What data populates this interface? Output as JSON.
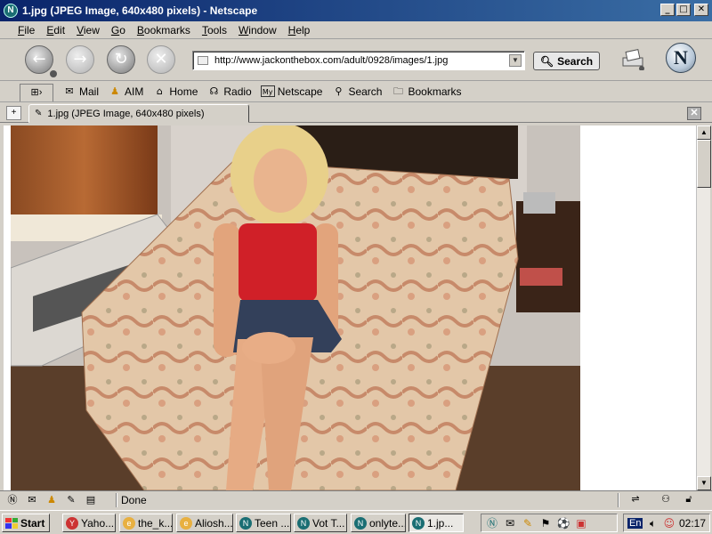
{
  "window": {
    "title": "1.jpg (JPEG Image, 640x480 pixels) - Netscape"
  },
  "menu": [
    "File",
    "Edit",
    "View",
    "Go",
    "Bookmarks",
    "Tools",
    "Window",
    "Help"
  ],
  "nav": {
    "url": "http://www.jackonthebox.com/adult/0928/images/1.jpg",
    "search_label": "Search"
  },
  "personal_toolbar": [
    {
      "label": "Mail",
      "icon": "mail-icon"
    },
    {
      "label": "AIM",
      "icon": "aim-icon"
    },
    {
      "label": "Home",
      "icon": "home-icon"
    },
    {
      "label": "Radio",
      "icon": "radio-icon"
    },
    {
      "label": "Netscape",
      "icon": "my-netscape-icon"
    },
    {
      "label": "Search",
      "icon": "search-icon"
    },
    {
      "label": "Bookmarks",
      "icon": "bookmarks-folder-icon"
    }
  ],
  "tab": {
    "label": "1.jpg (JPEG Image, 640x480 pixels)"
  },
  "status": {
    "text": "Done"
  },
  "taskbar": {
    "start_label": "Start",
    "tasks": [
      "Yaho...",
      "the_k...",
      "Aliosh...",
      "Teen ...",
      "Vot T...",
      "onlyte...",
      "1.jp..."
    ],
    "active_task": "1.jp...",
    "tray_lang": "En",
    "clock": "02:17"
  }
}
